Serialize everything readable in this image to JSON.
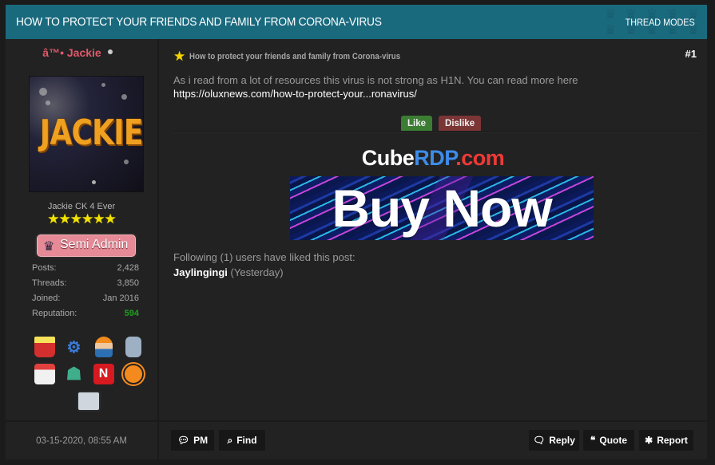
{
  "thread": {
    "title": "HOW TO PROTECT YOUR FRIENDS AND FAMILY FROM CORONA-VIRUS",
    "modes_label": "THREAD MODES",
    "header_color": "#1a6a7e"
  },
  "author": {
    "username": "â™• Jackie",
    "avatar_text": "JACKIE",
    "user_title": "Jackie CK 4 Ever",
    "stars": "★★★★★★",
    "star_count": 6,
    "group": {
      "icon": "crown-icon",
      "label": "Semi Admin"
    },
    "stats": [
      {
        "label": "Posts:",
        "value": "2,428"
      },
      {
        "label": "Threads:",
        "value": "3,850"
      },
      {
        "label": "Joined:",
        "value": "Jan 2016"
      },
      {
        "label": "Reputation:",
        "value": "594",
        "color": "#1f9e1f"
      }
    ],
    "awards": [
      "popcorn-icon",
      "steam-icon",
      "worker-icon",
      "robot-icon",
      "calendar-icon",
      "android-icon",
      "netflix-icon",
      "orange-planet-icon",
      "console-icon"
    ]
  },
  "post": {
    "subject": "How to protect your friends and family from Corona-virus",
    "number": "#1",
    "body_text": "As i read from a lot of resources this virus is not strong as H1N. You can read more here",
    "link_text": "https://oluxnews.com/how-to-protect-your...ronavirus/",
    "like_label": "Like",
    "dislike_label": "Dislike",
    "ad": {
      "title_part1": "Cube",
      "title_part2": "RDP",
      "title_part3": ".com",
      "banner_text": "Buy Now"
    },
    "likes_summary": "Following (1) users have liked this post:",
    "liker_name": "Jaylingingi",
    "liker_time": "(Yesterday)",
    "date": "03-15-2020, 08:55 AM"
  },
  "buttons": {
    "pm": "PM",
    "find": "Find",
    "reply": "Reply",
    "quote": "Quote",
    "report": "Report"
  }
}
